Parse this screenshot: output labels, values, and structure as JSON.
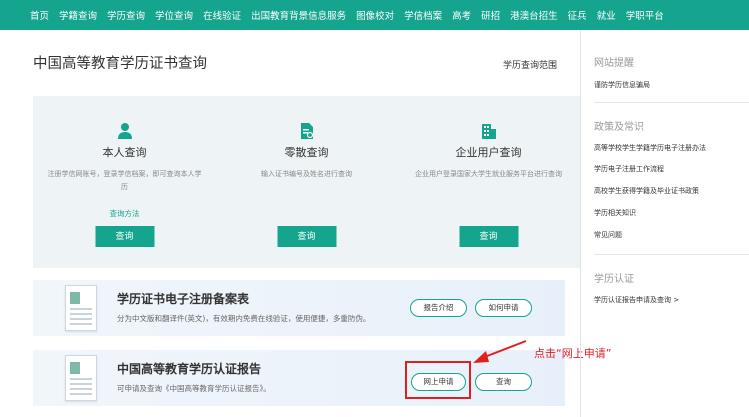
{
  "nav": {
    "items": [
      "首页",
      "学籍查询",
      "学历查询",
      "学位查询",
      "在线验证",
      "出国教育背景信息服务",
      "图像校对",
      "学信档案",
      "高考",
      "研招",
      "港澳台招生",
      "征兵",
      "就业",
      "学职平台"
    ]
  },
  "main": {
    "title": "中国高等教育学历证书查询",
    "scope_link": "学历查询范围",
    "cards": [
      {
        "title": "本人查询",
        "desc": "注册学信网账号，登录学信档案，即可查询本人学历",
        "link": "查询方法",
        "button": "查询"
      },
      {
        "title": "零散查询",
        "desc": "输入证书编号及姓名进行查询",
        "link": "",
        "button": "查询"
      },
      {
        "title": "企业用户查询",
        "desc": "企业用户登录国家大学生就业服务平台进行查询",
        "link": "",
        "button": "查询"
      }
    ],
    "banners": [
      {
        "title": "学历证书电子注册备案表",
        "desc": "分为中文版和翻译件(英文)，有效期内免费在线验证，使用便捷，多重防伪。",
        "buttons": [
          "报告介绍",
          "如何申请"
        ]
      },
      {
        "title": "中国高等教育学历认证报告",
        "desc": "可申请及查询《中国高等教育学历认证报告》。",
        "buttons": [
          "网上申请",
          "查询"
        ]
      }
    ],
    "annotation": "点击“网上申请”"
  },
  "sidebar": {
    "sections": [
      {
        "heading": "网站提醒",
        "items": [
          "谨防学历信息骗局"
        ]
      },
      {
        "heading": "政策及常识",
        "items": [
          "高等学校学生学籍学历电子注册办法",
          "学历电子注册工作流程",
          "高校学生获得学籍及毕业证书政策",
          "学历相关知识",
          "常见问题"
        ]
      },
      {
        "heading": "学历认证",
        "items": [
          "学历认证报告申请及查询 >"
        ]
      }
    ]
  },
  "colors": {
    "brand": "#15a48e",
    "annotation": "#e02020"
  }
}
